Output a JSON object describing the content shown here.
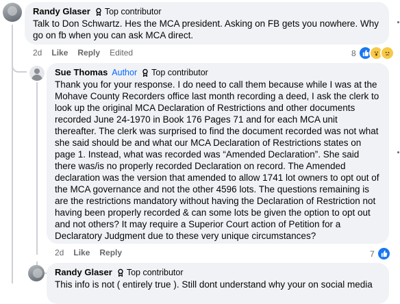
{
  "comments": [
    {
      "author": "Randy Glaser",
      "badge": "Top contributor",
      "text": "Talk to Don Schwartz. Hes the MCA president. Asking on FB gets you nowhere. Why go on fb when you can ask MCA direct.",
      "time": "2d",
      "like": "Like",
      "reply": "Reply",
      "edited": "Edited",
      "reaction_count": "8",
      "reactions": [
        "like-icon",
        "wow-icon",
        "sad-icon"
      ]
    },
    {
      "author": "Sue Thomas",
      "author_tag": "Author",
      "badge": "Top contributor",
      "text": "Thank you for your response. I do need to call them because while I was at the Mohave County Recorders office last month recording a deed, I ask the clerk to look up the original MCA Declaration of Restrictions and other documents recorded June 24-1970 in Book 176 Pages 71 and for each MCA unit thereafter. The clerk was surprised to find the document recorded was not what she said should be and what our MCA Declaration of Restrictions states on page 1. Instead, what was recorded was “Amended Declaration”. She said there was/is no properly recorded Declaration on record. The Amended declaration was the version that amended to allow 1741 lot owners to opt out of the MCA governance and not the other 4596 lots. The questions remaining is are the restrictions mandatory without having the Declaration of Restriction not having been properly recorded & can some lots be given the option to opt out and not others? It may require a Superior Court action of Petition for a Declaratory Judgment due to these very unique circumstances?",
      "time": "2d",
      "like": "Like",
      "reply": "Reply",
      "reaction_count": "7",
      "reactions": [
        "like-icon"
      ]
    },
    {
      "author": "Randy Glaser",
      "badge": "Top contributor",
      "text": "This info is not ( entirely true ). Still dont understand why your on social media"
    }
  ],
  "colors": {
    "bubble": "#f0f2f5",
    "link_blue": "#0866ff",
    "meta_gray": "#65676b",
    "line": "#ced0d4"
  }
}
